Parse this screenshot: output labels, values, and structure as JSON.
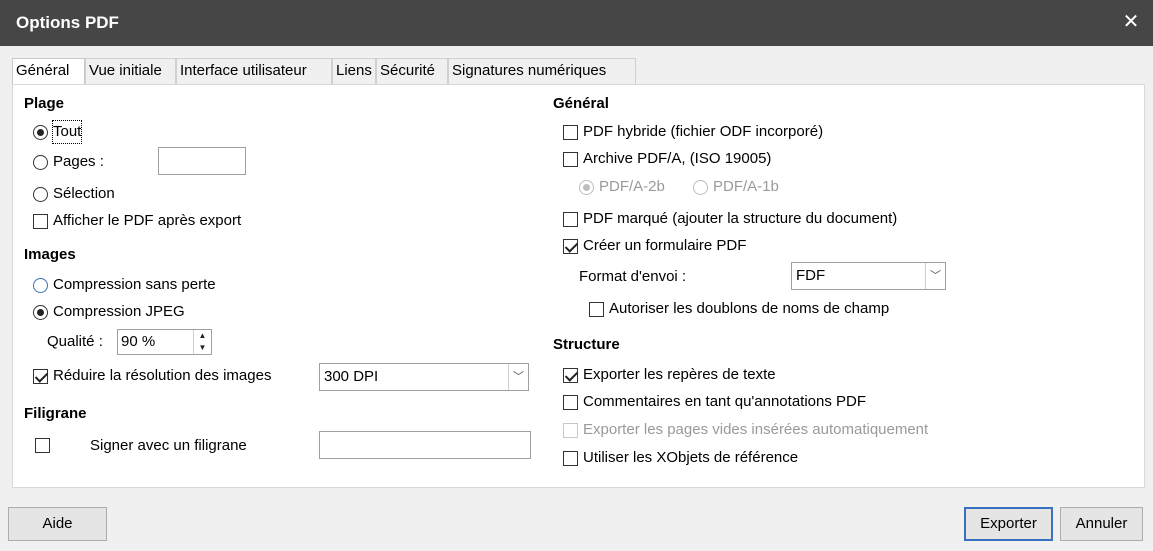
{
  "window": {
    "title": "Options PDF"
  },
  "tabs": [
    "Général",
    "Vue initiale",
    "Interface utilisateur",
    "Liens",
    "Sécurité",
    "Signatures numériques"
  ],
  "plage": {
    "heading": "Plage",
    "tout": "Tout",
    "pages_label": "Pages :",
    "pages_value": "",
    "selection": "Sélection",
    "afficher": "Afficher le PDF après export"
  },
  "images": {
    "heading": "Images",
    "sans_perte": "Compression sans perte",
    "jpeg": "Compression JPEG",
    "qualite_label": "Qualité :",
    "qualite_value": "90 %",
    "reduire": "Réduire la résolution des images",
    "dpi_value": "300 DPI"
  },
  "filigrane": {
    "heading": "Filigrane",
    "signer": "Signer avec un filigrane",
    "value": ""
  },
  "general": {
    "heading": "Général",
    "hybride": "PDF hybride (fichier ODF incorporé)",
    "archive": "Archive PDF/A, (ISO 19005)",
    "pdfa2b": "PDF/A-2b",
    "pdfa1b": "PDF/A-1b",
    "marque": "PDF marqué (ajouter la structure du document)",
    "formulaire": "Créer un formulaire PDF",
    "format_label": "Format d'envoi :",
    "format_value": "FDF",
    "doublons": "Autoriser les doublons de noms de champ"
  },
  "structure": {
    "heading": "Structure",
    "reperes": "Exporter les repères de texte",
    "commentaires": "Commentaires en tant qu'annotations PDF",
    "pages_vides": "Exporter les pages vides insérées automatiquement",
    "xobjets": "Utiliser les XObjets de référence"
  },
  "buttons": {
    "aide": "Aide",
    "exporter": "Exporter",
    "annuler": "Annuler"
  }
}
